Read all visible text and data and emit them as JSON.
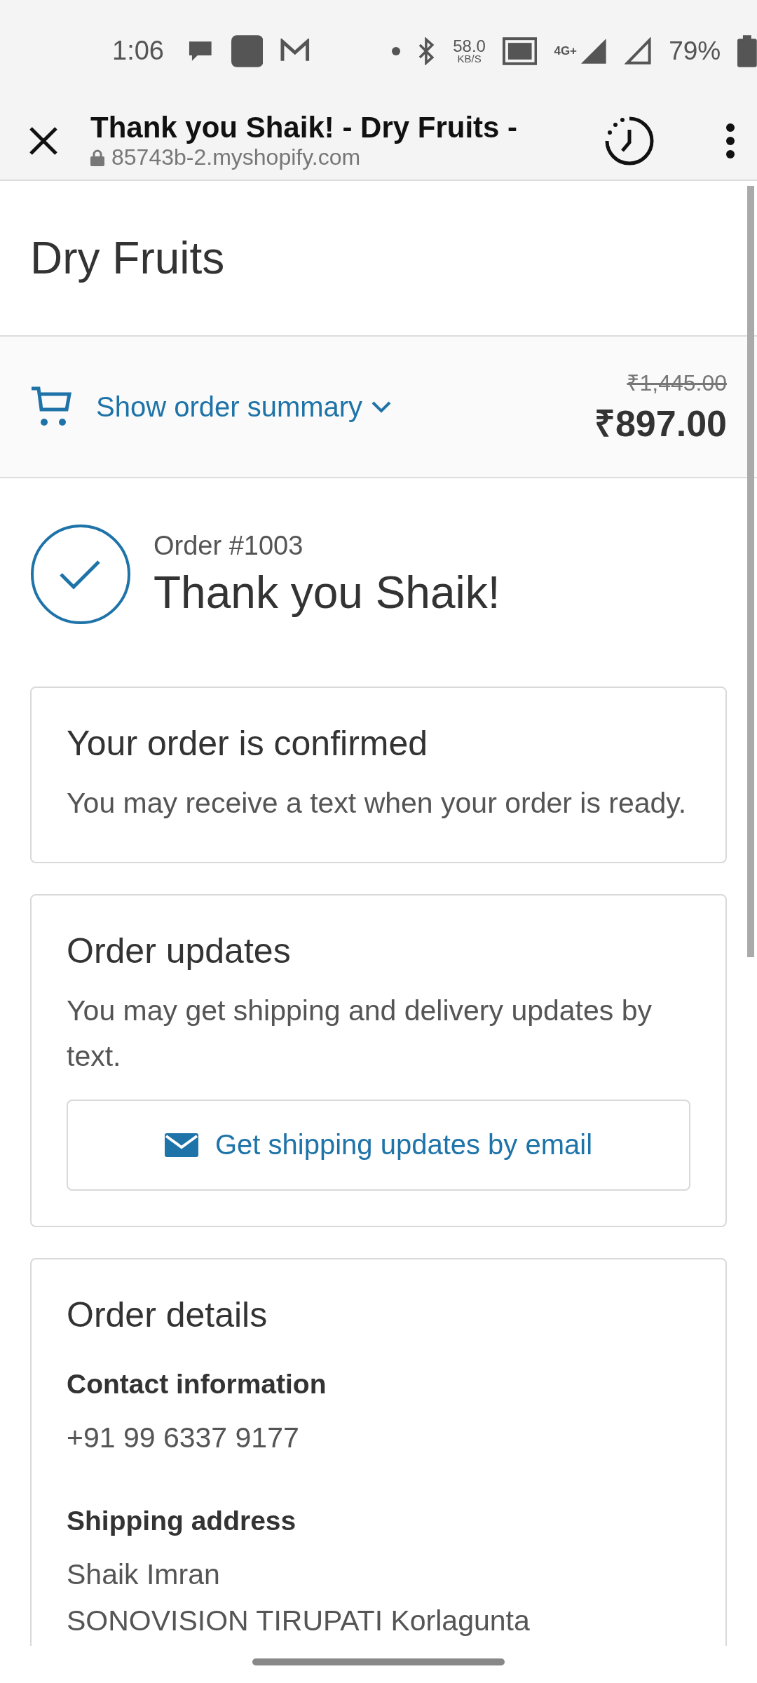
{
  "status_bar": {
    "time": "1:06",
    "speed": "58.0",
    "speed_unit": "KB/S",
    "network": "4G+",
    "battery": "79%"
  },
  "browser": {
    "title": "Thank you Shaik! - Dry Fruits -",
    "url": "85743b-2.myshopify.com"
  },
  "shop": {
    "name": "Dry Fruits"
  },
  "summary": {
    "toggle": "Show order summary",
    "expanded": false,
    "original_price": "₹1,445.00",
    "price": "₹897.00"
  },
  "order": {
    "number": "Order #1003",
    "greeting": "Thank you Shaik!"
  },
  "cards": [
    {
      "title": "Your order is confirmed",
      "text": "You may receive a text when your order is ready."
    },
    {
      "title": "Order updates",
      "text": "You may get shipping and delivery updates by text.",
      "button": "Get shipping updates by email"
    }
  ],
  "details": {
    "title": "Order details",
    "sections": [
      {
        "heading": "Contact information",
        "lines": [
          "+91 99 6337 9177"
        ]
      },
      {
        "heading": "Shipping address",
        "lines": [
          "Shaik Imran",
          "SONOVISION TIRUPATI Korlagunta"
        ]
      }
    ]
  }
}
